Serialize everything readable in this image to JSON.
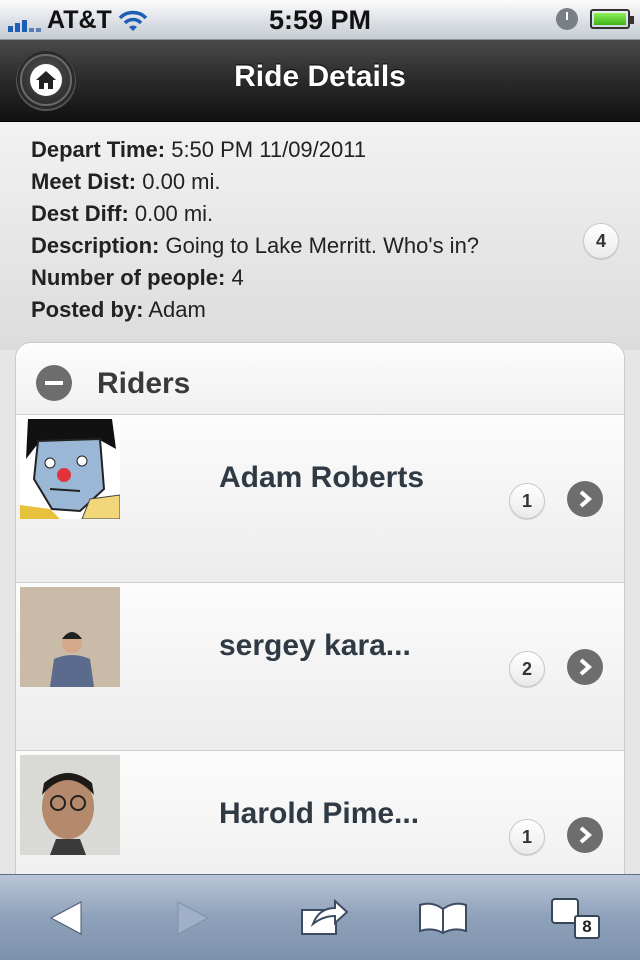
{
  "status_bar": {
    "carrier": "AT&T",
    "time": "5:59 PM"
  },
  "header": {
    "title": "Ride Details",
    "home_icon": "home-icon"
  },
  "details": {
    "depart_time_label": "Depart Time:",
    "depart_time_value": "5:50 PM 11/09/2011",
    "meet_dist_label": "Meet Dist:",
    "meet_dist_value": "0.00 mi.",
    "dest_diff_label": "Dest Diff:",
    "dest_diff_value": "0.00 mi.",
    "description_label": "Description:",
    "description_value": "Going to Lake Merritt. Who's in?",
    "people_label": "Number of people:",
    "people_value": "4",
    "posted_by_label": "Posted by:",
    "posted_by_value": "Adam",
    "count_badge": "4"
  },
  "riders": {
    "title": "Riders",
    "items": [
      {
        "name": "Adam Roberts",
        "count": "1"
      },
      {
        "name": "sergey kara...",
        "count": "2"
      },
      {
        "name": "Harold Pime...",
        "count": "1"
      }
    ]
  },
  "toolbar": {
    "tabs_count": "8"
  },
  "colors": {
    "header_bg": "#1f1f1f",
    "toolbar_bg": "#8ea1ba",
    "rider_name": "#2f3a45"
  }
}
